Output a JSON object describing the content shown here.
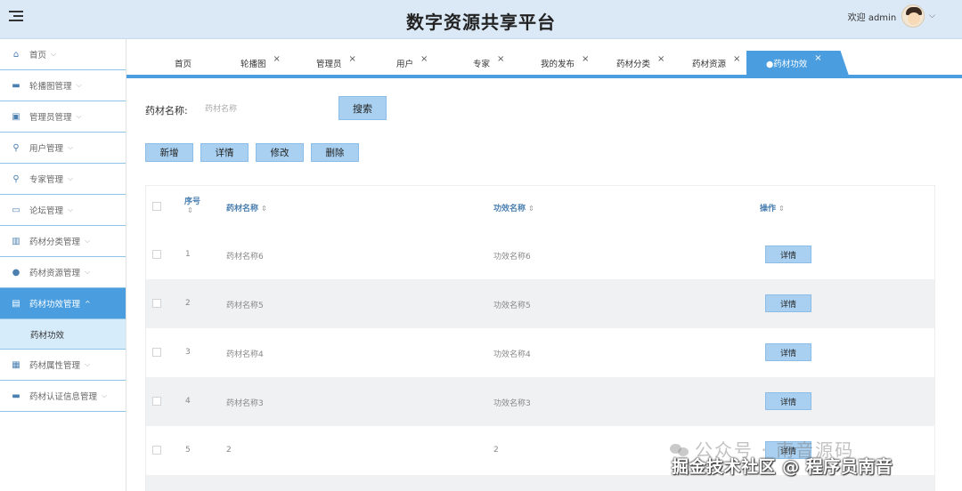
{
  "app": {
    "title": "数字资源共享平台"
  },
  "user": {
    "greeting": "欢迎 admin"
  },
  "sidebar": {
    "items": [
      {
        "label": "首页",
        "icon": "home-icon",
        "glyph": "⌂"
      },
      {
        "label": "轮播图管理",
        "icon": "image-icon",
        "glyph": "▬"
      },
      {
        "label": "管理员管理",
        "icon": "briefcase-icon",
        "glyph": "▣"
      },
      {
        "label": "用户管理",
        "icon": "user-icon",
        "glyph": "⚲"
      },
      {
        "label": "专家管理",
        "icon": "user-icon",
        "glyph": "⚲"
      },
      {
        "label": "论坛管理",
        "icon": "card-icon",
        "glyph": "▭"
      },
      {
        "label": "药材分类管理",
        "icon": "book-icon",
        "glyph": "▥"
      },
      {
        "label": "药材资源管理",
        "icon": "drop-icon",
        "glyph": "●"
      },
      {
        "label": "药材功效管理",
        "icon": "folder-icon",
        "glyph": "▤",
        "active": true
      },
      {
        "label": "药材属性管理",
        "icon": "archive-icon",
        "glyph": "▦"
      },
      {
        "label": "药材认证信息管理",
        "icon": "monitor-icon",
        "glyph": "▬"
      }
    ],
    "sub_item": "药材功效"
  },
  "tabs": [
    {
      "label": "首页",
      "closable": false
    },
    {
      "label": "轮播图",
      "closable": true
    },
    {
      "label": "管理员",
      "closable": true
    },
    {
      "label": "用户",
      "closable": true
    },
    {
      "label": "专家",
      "closable": true
    },
    {
      "label": "我的发布",
      "closable": true
    },
    {
      "label": "药材分类",
      "closable": true
    },
    {
      "label": "药材资源",
      "closable": true
    },
    {
      "label": "●药材功效",
      "closable": true,
      "active": true
    }
  ],
  "search": {
    "label": "药材名称:",
    "placeholder": "药材名称",
    "button": "搜索"
  },
  "actions": {
    "add": "新增",
    "detail": "详情",
    "edit": "修改",
    "delete": "删除"
  },
  "table": {
    "headers": {
      "index": "序号",
      "name": "药材名称",
      "effect": "功效名称",
      "ops": "操作"
    },
    "detail_label": "详情",
    "rows": [
      {
        "index": "1",
        "name": "药材名称6",
        "effect": "功效名称6"
      },
      {
        "index": "2",
        "name": "药材名称5",
        "effect": "功效名称5"
      },
      {
        "index": "3",
        "name": "药材名称4",
        "effect": "功效名称4"
      },
      {
        "index": "4",
        "name": "药材名称3",
        "effect": "功效名称3"
      },
      {
        "index": "5",
        "name": "2",
        "effect": "2"
      }
    ]
  },
  "watermark": {
    "line1": "公众号 · 南音源码",
    "line2": "掘金技术社区 @ 程序员南音"
  },
  "colors": {
    "primary": "#4a9ee0",
    "topbar": "#dbe9f6",
    "button": "#a9d0f0"
  }
}
